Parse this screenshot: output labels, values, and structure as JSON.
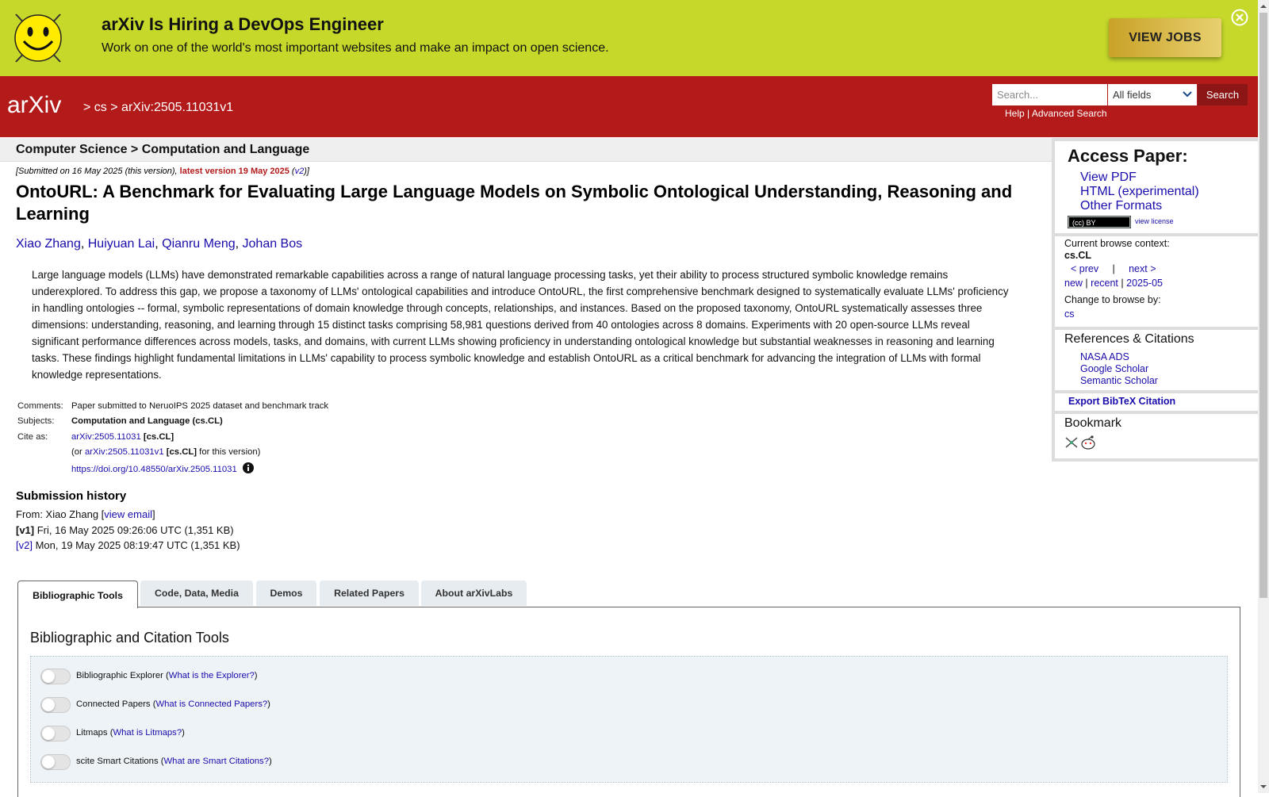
{
  "banner": {
    "title": "arXiv Is Hiring a DevOps Engineer",
    "subtitle": "Work on one of the world's most important websites and make an impact on open science.",
    "button": "VIEW JOBS",
    "background_color": "#c6d92a"
  },
  "header": {
    "logo_text": "arXiv",
    "breadcrumb_sep": ">",
    "breadcrumb_cs": "cs",
    "breadcrumb_id": "arXiv:2505.11031v1",
    "search_placeholder": "Search...",
    "search_field": "All fields",
    "search_button": "Search",
    "help": "Help",
    "divider": "|",
    "advanced_search": "Advanced Search",
    "background_color": "#b31b1b"
  },
  "subject_bar": "Computer Science > Computation and Language",
  "paper": {
    "submitted_prefix": "[Submitted on 16 May 2025 (this version), ",
    "latest_version": "latest version 19 May 2025",
    "submitted_v2_open": " (",
    "v2": "v2",
    "submitted_suffix": ")]",
    "title": "OntoURL: A Benchmark for Evaluating Large Language Models on Symbolic Ontological Understanding, Reasoning and Learning",
    "authors": [
      "Xiao Zhang",
      "Huiyuan Lai",
      "Qianru Meng",
      "Johan Bos"
    ],
    "comma": ", ",
    "abstract": "Large language models (LLMs) have demonstrated remarkable capabilities across a range of natural language processing tasks, yet their ability to process structured symbolic knowledge remains underexplored. To address this gap, we propose a taxonomy of LLMs' ontological capabilities and introduce OntoURL, the first comprehensive benchmark designed to systematically evaluate LLMs' proficiency in handling ontologies -- formal, symbolic representations of domain knowledge through concepts, relationships, and instances. Based on the proposed taxonomy, OntoURL systematically assesses three dimensions: understanding, reasoning, and learning through 15 distinct tasks comprising 58,981 questions derived from 40 ontologies across 8 domains. Experiments with 20 open-source LLMs reveal significant performance differences across models, tasks, and domains, with current LLMs showing proficiency in understanding ontological knowledge but substantial weaknesses in reasoning and learning tasks. These findings highlight fundamental limitations in LLMs' capability to process symbolic knowledge and establish OntoURL as a critical benchmark for advancing the integration of LLMs with formal knowledge representations."
  },
  "meta": {
    "comments_label": "Comments:",
    "comments": "Paper submitted to NeruoIPS 2025 dataset and benchmark track",
    "subjects_label": "Subjects:",
    "subjects": "Computation and Language (cs.CL)",
    "cite_label": "Cite as:",
    "cite_id": "arXiv:2505.11031",
    "cite_cat": "[cs.CL]",
    "or_prefix": "(or ",
    "cite_version": "arXiv:2505.11031v1",
    "or_suffix": " for this version)",
    "doi": "https://doi.org/10.48550/arXiv.2505.11031"
  },
  "history": {
    "title": "Submission history",
    "from": "From: Xiao Zhang [",
    "view_email": "view email",
    "close_bracket": "]",
    "v1_label": "[v1]",
    "v1": " Fri, 16 May 2025 09:26:06 UTC (1,351 KB)",
    "v2_label": "[v2]",
    "v2": " Mon, 19 May 2025 08:19:47 UTC (1,351 KB)"
  },
  "tabs": [
    {
      "label": "Bibliographic Tools",
      "active": true
    },
    {
      "label": "Code, Data, Media",
      "active": false
    },
    {
      "label": "Demos",
      "active": false
    },
    {
      "label": "Related Papers",
      "active": false
    },
    {
      "label": "About arXivLabs",
      "active": false
    }
  ],
  "tools": {
    "title": "Bibliographic and Citation Tools",
    "items": [
      {
        "name": "Bibliographic Explorer",
        "link": "What is the Explorer?"
      },
      {
        "name": "Connected Papers",
        "link": "What is Connected Papers?"
      },
      {
        "name": "Litmaps",
        "link": "What is Litmaps?"
      },
      {
        "name": "scite Smart Citations",
        "link": "What are Smart Citations?"
      }
    ]
  },
  "sidebar": {
    "access_title": "Access Paper:",
    "view_pdf": "View PDF",
    "html": "HTML (experimental)",
    "other_formats": "Other Formats",
    "view_license": "view license",
    "license_badge": "(cc) BY",
    "browse_context_label": "Current browse context:",
    "browse_context": "cs.CL",
    "prev": "< prev",
    "bar": "|",
    "next": "next >",
    "new": "new",
    "recent": "recent",
    "month": "2025-05",
    "change_browse": "Change to browse by:",
    "cs": "cs",
    "refs_title": "References & Citations",
    "nasa": "NASA ADS",
    "google": "Google Scholar",
    "semantic": "Semantic Scholar",
    "export": "Export BibTeX Citation",
    "bookmark": "Bookmark"
  }
}
